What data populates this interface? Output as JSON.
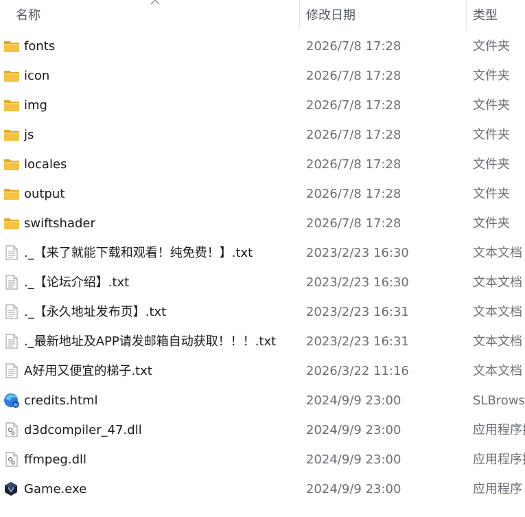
{
  "columns": {
    "name": "名称",
    "date": "修改日期",
    "type": "类型"
  },
  "files": [
    {
      "name": "fonts",
      "date": "2026/7/8 17:28",
      "type": "文件夹",
      "icon": "folder-icon"
    },
    {
      "name": "icon",
      "date": "2026/7/8 17:28",
      "type": "文件夹",
      "icon": "folder-icon"
    },
    {
      "name": "img",
      "date": "2026/7/8 17:28",
      "type": "文件夹",
      "icon": "folder-icon"
    },
    {
      "name": "js",
      "date": "2026/7/8 17:28",
      "type": "文件夹",
      "icon": "folder-icon"
    },
    {
      "name": "locales",
      "date": "2026/7/8 17:28",
      "type": "文件夹",
      "icon": "folder-icon"
    },
    {
      "name": "output",
      "date": "2026/7/8 17:28",
      "type": "文件夹",
      "icon": "folder-icon"
    },
    {
      "name": "swiftshader",
      "date": "2026/7/8 17:28",
      "type": "文件夹",
      "icon": "folder-icon"
    },
    {
      "name": "._【来了就能下载和观看！纯免费！】.txt",
      "date": "2023/2/23 16:30",
      "type": "文本文档",
      "icon": "text-file-icon"
    },
    {
      "name": "._【论坛介绍】.txt",
      "date": "2023/2/23 16:30",
      "type": "文本文档",
      "icon": "text-file-icon"
    },
    {
      "name": "._【永久地址发布页】.txt",
      "date": "2023/2/23 16:31",
      "type": "文本文档",
      "icon": "text-file-icon"
    },
    {
      "name": "._最新地址及APP请发邮箱自动获取！！！.txt",
      "date": "2023/2/23 16:31",
      "type": "文本文档",
      "icon": "text-file-icon"
    },
    {
      "name": "A好用又便宜的梯子.txt",
      "date": "2026/3/22 11:16",
      "type": "文本文档",
      "icon": "text-file-icon"
    },
    {
      "name": "credits.html",
      "date": "2024/9/9 23:00",
      "type": "SLBrowse",
      "icon": "browser-html-icon"
    },
    {
      "name": "d3dcompiler_47.dll",
      "date": "2024/9/9 23:00",
      "type": "应用程序扩",
      "icon": "dll-file-icon"
    },
    {
      "name": "ffmpeg.dll",
      "date": "2024/9/9 23:00",
      "type": "应用程序扩",
      "icon": "dll-file-icon"
    },
    {
      "name": "Game.exe",
      "date": "2024/9/9 23:00",
      "type": "应用程序",
      "icon": "game-exe-icon"
    }
  ],
  "colors": {
    "folder": "#f5c242",
    "folder_dark": "#e3a82a",
    "header_text": "#555b63",
    "secondary_text": "#6b6f75"
  }
}
